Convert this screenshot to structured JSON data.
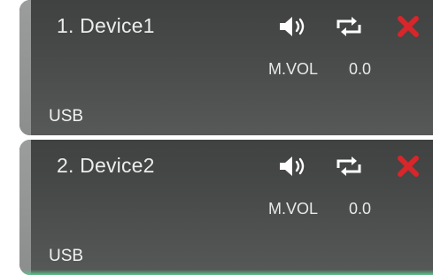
{
  "devices": [
    {
      "name": "1. Device1",
      "volume_label": "M.VOL",
      "volume_value": "0.0",
      "source": "USB",
      "icons": [
        "speaker-icon",
        "loop-icon",
        "remove-icon"
      ]
    },
    {
      "name": "2. Device2",
      "volume_label": "M.VOL",
      "volume_value": "0.0",
      "source": "USB",
      "icons": [
        "speaker-icon",
        "loop-icon",
        "remove-icon"
      ],
      "active": true
    }
  ],
  "colors": {
    "card_background": "#474a49",
    "accent_bar": "#9b9d9c",
    "text": "#ececec",
    "icon_white": "#ffffff",
    "remove_red": "#d8262a",
    "active_green": "#5fc28d"
  }
}
